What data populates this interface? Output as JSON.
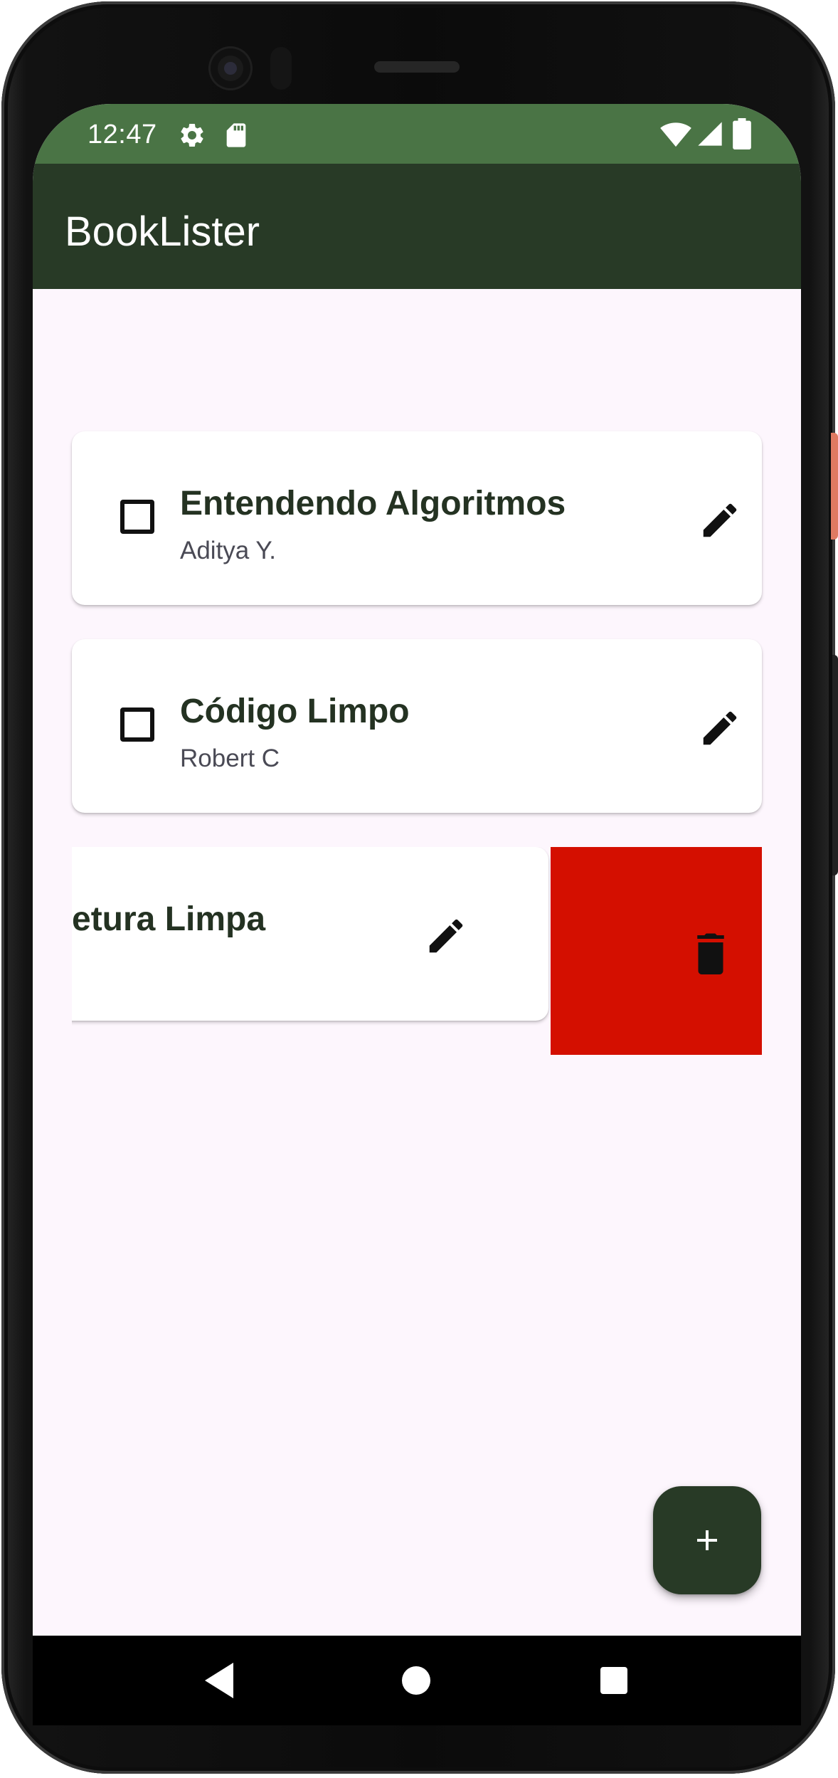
{
  "status_bar": {
    "time": "12:47",
    "color": "#4a7445",
    "icons_left": [
      "gear-icon",
      "sd-card-icon"
    ],
    "icons_right": [
      "wifi-icon",
      "signal-icon",
      "battery-icon"
    ]
  },
  "app_bar": {
    "title": "BookLister",
    "color": "#283a26"
  },
  "books": [
    {
      "title": "Entendendo Algoritmos",
      "author": "Aditya Y.",
      "checked": false
    },
    {
      "title": "Código Limpo",
      "author": "Robert C",
      "checked": false
    },
    {
      "title": "etura Limpa",
      "author": "",
      "swiped": true
    }
  ],
  "swipe_action": {
    "icon": "trash-icon",
    "color": "#d40f00"
  },
  "fab": {
    "icon": "plus-icon",
    "color": "#283a26"
  },
  "nav_bar": {
    "buttons": [
      "back-icon",
      "home-icon",
      "recents-icon"
    ]
  }
}
